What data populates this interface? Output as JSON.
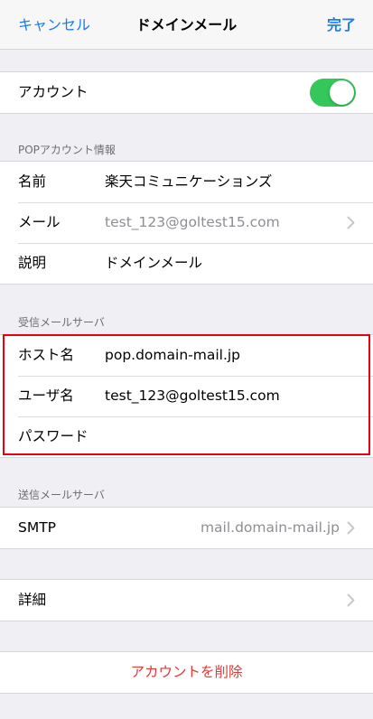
{
  "nav": {
    "cancel_label": "キャンセル",
    "title": "ドメインメール",
    "done_label": "完了"
  },
  "account_toggle": {
    "label": "アカウント",
    "enabled": true
  },
  "pop_info": {
    "header": "POPアカウント情報",
    "name_label": "名前",
    "name_value": "楽天コミュニケーションズ",
    "mail_label": "メール",
    "mail_value": "test_123@goltest15.com",
    "description_label": "説明",
    "description_value": "ドメインメール"
  },
  "incoming": {
    "header": "受信メールサーバ",
    "host_label": "ホスト名",
    "host_value": "pop.domain-mail.jp",
    "user_label": "ユーザ名",
    "user_value": "test_123@goltest15.com",
    "password_label": "パスワード",
    "password_value": ""
  },
  "outgoing": {
    "header": "送信メールサーバ",
    "smtp_label": "SMTP",
    "smtp_value": "mail.domain-mail.jp"
  },
  "advanced": {
    "label": "詳細"
  },
  "delete": {
    "label": "アカウントを削除"
  },
  "colors": {
    "accent": "#1a7cf0",
    "toggle_on": "#34c759",
    "destructive": "#e53935",
    "highlight_border": "#e60012"
  }
}
